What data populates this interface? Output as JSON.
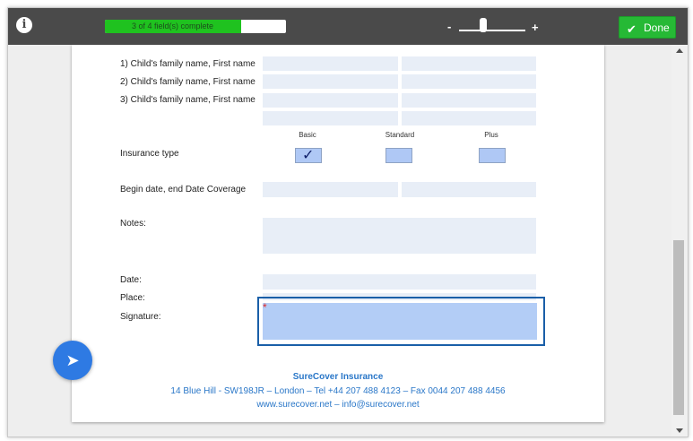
{
  "toolbar": {
    "info_icon": "i",
    "progress": {
      "text": "3 of 4 field(s) complete",
      "fraction": 0.75
    },
    "zoom": {
      "minus": "-",
      "plus": "+"
    },
    "done_label": "Done",
    "done_icon": "✔"
  },
  "form": {
    "children": [
      {
        "label": "1) Child's family name, First name"
      },
      {
        "label": "2) Child's family name, First name"
      },
      {
        "label": "3) Child's family name, First name"
      }
    ],
    "insurance": {
      "label": "Insurance type",
      "options": [
        {
          "name": "Basic",
          "checked": true
        },
        {
          "name": "Standard",
          "checked": false
        },
        {
          "name": "Plus",
          "checked": false
        }
      ],
      "check_glyph": "✓"
    },
    "coverage_label": "Begin date, end Date Coverage",
    "notes_label": "Notes:",
    "date_label": "Date:",
    "place_label": "Place:",
    "signature_label": "Signature:",
    "required_mark": "*"
  },
  "footer": {
    "company": "SureCover Insurance",
    "address": "14 Blue Hill - SW198JR – London – Tel +44 207 488 4123 – Fax 0044 207 488 4456",
    "web": "www.surecover.net – info@surecover.net"
  },
  "next_button_glyph": "➤",
  "colors": {
    "toolbar": "#4a4a4a",
    "done": "#26b935",
    "progress_fill": "#1fc21f",
    "field_bg": "#e8eef7",
    "accent_blue": "#2e7ae3",
    "footer_text": "#2a77c8"
  }
}
